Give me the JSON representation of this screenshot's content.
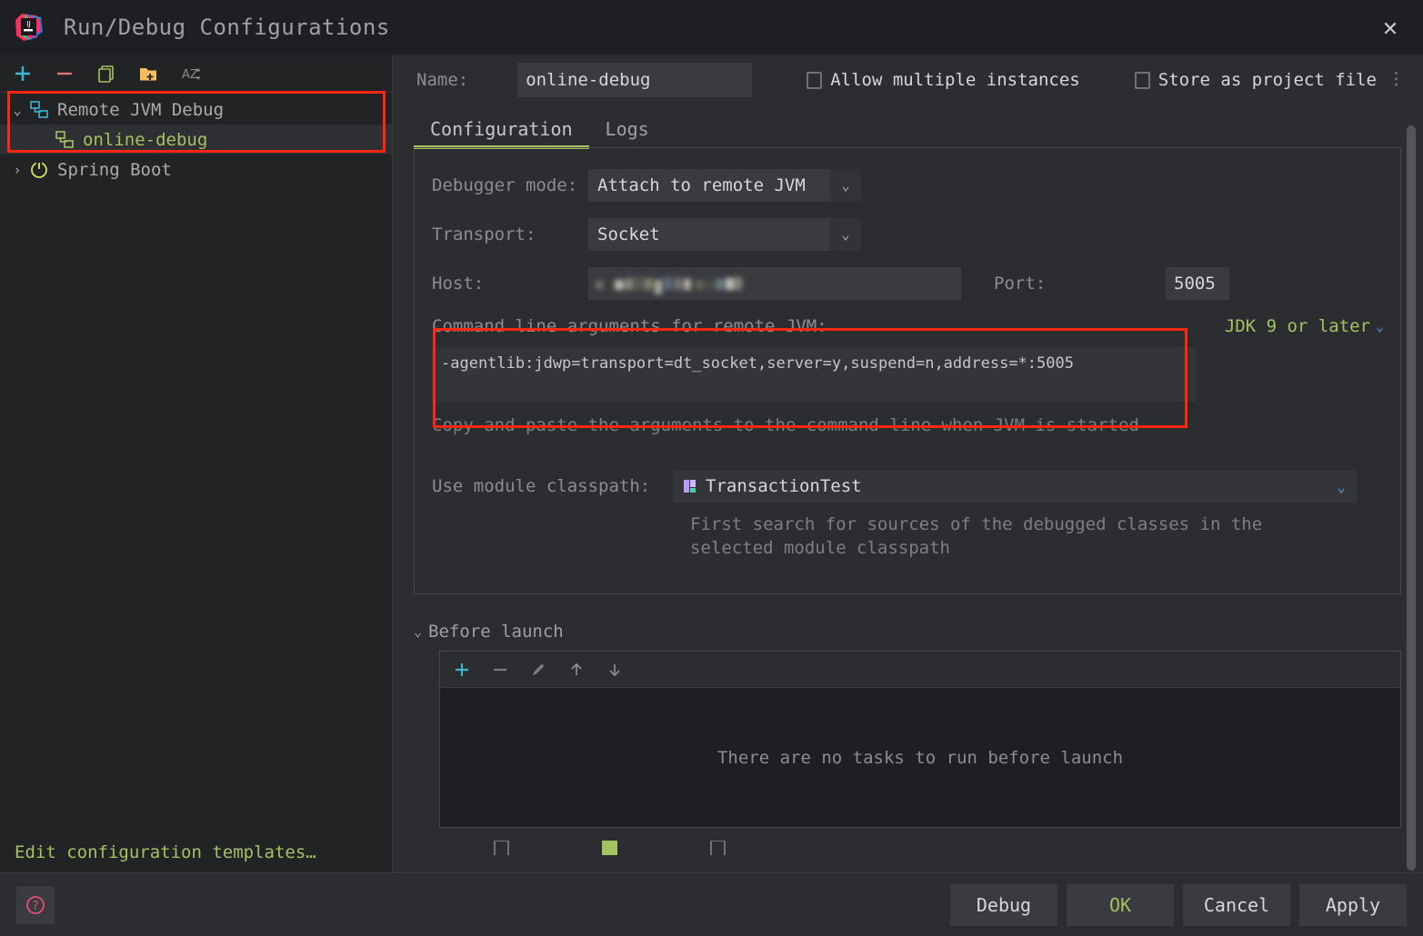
{
  "window": {
    "title": "Run/Debug Configurations",
    "close_label": "✕",
    "logo_name": "intellij-idea-logo"
  },
  "left_panel": {
    "toolbar": [
      {
        "name": "add-configuration-button",
        "glyph": "+"
      },
      {
        "name": "remove-configuration-button",
        "glyph": "−"
      },
      {
        "name": "copy-configuration-button",
        "glyph": "copy-icon"
      },
      {
        "name": "new-folder-button",
        "glyph": "folder-add-icon"
      },
      {
        "name": "sort-configurations-button",
        "glyph": "AZ"
      }
    ],
    "tree": [
      {
        "label": "Remote JVM Debug",
        "arrow": "⌄",
        "selected": false,
        "level": 0
      },
      {
        "label": "online-debug",
        "arrow": "",
        "selected": true,
        "level": 1
      },
      {
        "label": "Spring Boot",
        "arrow": "›",
        "selected": false,
        "level": 0
      }
    ],
    "edit_templates": "Edit configuration templates…"
  },
  "form": {
    "name_label": "Name:",
    "name_value": "online-debug",
    "allow_multiple_instances": {
      "label": "Allow multiple instances",
      "checked": false
    },
    "store_as_project_file": {
      "label": "Store as project file",
      "checked": false
    },
    "kebab": "⋮",
    "tabs": [
      {
        "label": "Configuration",
        "active": true
      },
      {
        "label": "Logs",
        "active": false
      }
    ],
    "debugger_mode": {
      "label": "Debugger mode:",
      "value": "Attach to remote JVM"
    },
    "transport": {
      "label": "Transport:",
      "value": "Socket"
    },
    "host": {
      "label": "Host:",
      "value": ""
    },
    "port": {
      "label": "Port:",
      "value": "5005"
    },
    "command_line": {
      "title": "Command line arguments for remote JVM:",
      "value": "-agentlib:jdwp=transport=dt_socket,server=y,suspend=n,address=*:5005",
      "hint": "Copy and paste the arguments to the command line when JVM is started",
      "jdk_selector": "JDK 9 or later"
    },
    "module_classpath": {
      "label": "Use module classpath:",
      "value": "TransactionTest",
      "hint": "First search for sources of the debugged classes in the selected module classpath"
    },
    "before_launch": {
      "title": "Before launch",
      "chevron": "⌄",
      "toolbar": [
        {
          "name": "add-task-button",
          "glyph": "+"
        },
        {
          "name": "remove-task-button",
          "glyph": "−"
        },
        {
          "name": "edit-task-button",
          "glyph": "pencil-icon"
        },
        {
          "name": "move-task-up-button",
          "glyph": "↑"
        },
        {
          "name": "move-task-down-button",
          "glyph": "↓"
        }
      ],
      "empty_text": "There are no tasks to run before launch"
    }
  },
  "footer": {
    "help": "?",
    "buttons": [
      {
        "label": "Debug",
        "style": "normal"
      },
      {
        "label": "OK",
        "style": "green"
      },
      {
        "label": "Cancel",
        "style": "normal"
      },
      {
        "label": "Apply",
        "style": "normal"
      }
    ]
  },
  "colors": {
    "accent_green": "#a5c261",
    "highlight_red": "#fe2712",
    "link_blue": "#4a9fd4",
    "panel_bg": "#2b2d30",
    "sidebar_bg": "#222325",
    "field_bg": "#393b40"
  }
}
